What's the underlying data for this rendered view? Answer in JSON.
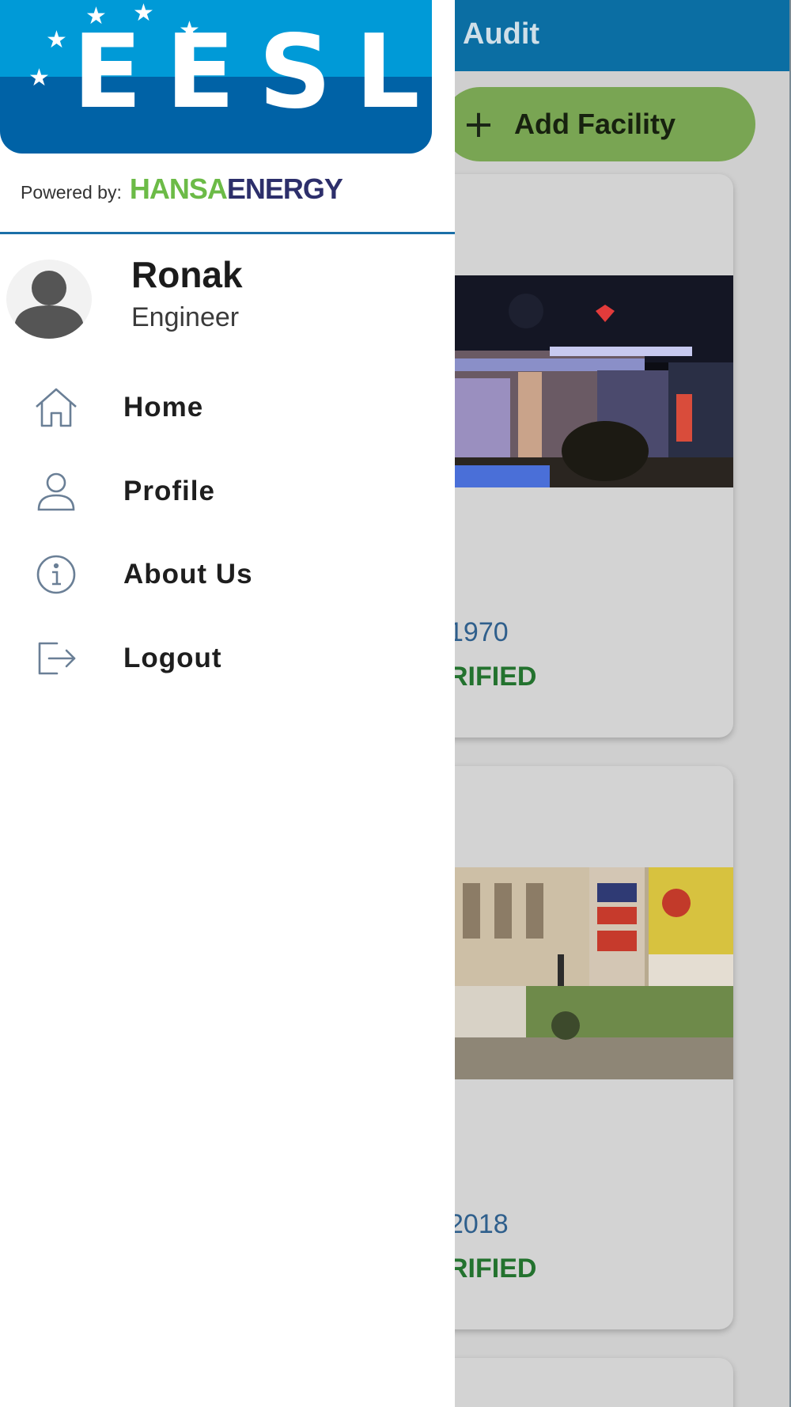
{
  "app_bar": {
    "title_fragment": "Audit"
  },
  "toolbar": {
    "add_label": "Add Facility",
    "add_icon": "plus-icon"
  },
  "facilities": [
    {
      "date_fragment": "1970",
      "status_fragment": "RIFIED"
    },
    {
      "date_fragment": "2018",
      "status_fragment": "RIFIED"
    }
  ],
  "drawer": {
    "logo_text": "EESL",
    "powered_by": "Powered by:",
    "brand_hansa": "HANSA",
    "brand_energy": "ENERGY",
    "user": {
      "name": "Ronak",
      "role": "Engineer"
    },
    "menu": [
      {
        "label": "Home",
        "icon": "home-icon"
      },
      {
        "label": "Profile",
        "icon": "user-icon"
      },
      {
        "label": "About Us",
        "icon": "info-icon"
      },
      {
        "label": "Logout",
        "icon": "logout-icon"
      }
    ]
  },
  "colors": {
    "app_bar": "#0b6ea3",
    "add_button": "#79a553",
    "status_green": "#23722e",
    "date_blue": "#2f5f8c",
    "logo_blue": "#0062a6",
    "logo_light_blue": "#009ad7",
    "hansa_green": "#6cbb47",
    "energy_navy": "#2d2f6b"
  }
}
